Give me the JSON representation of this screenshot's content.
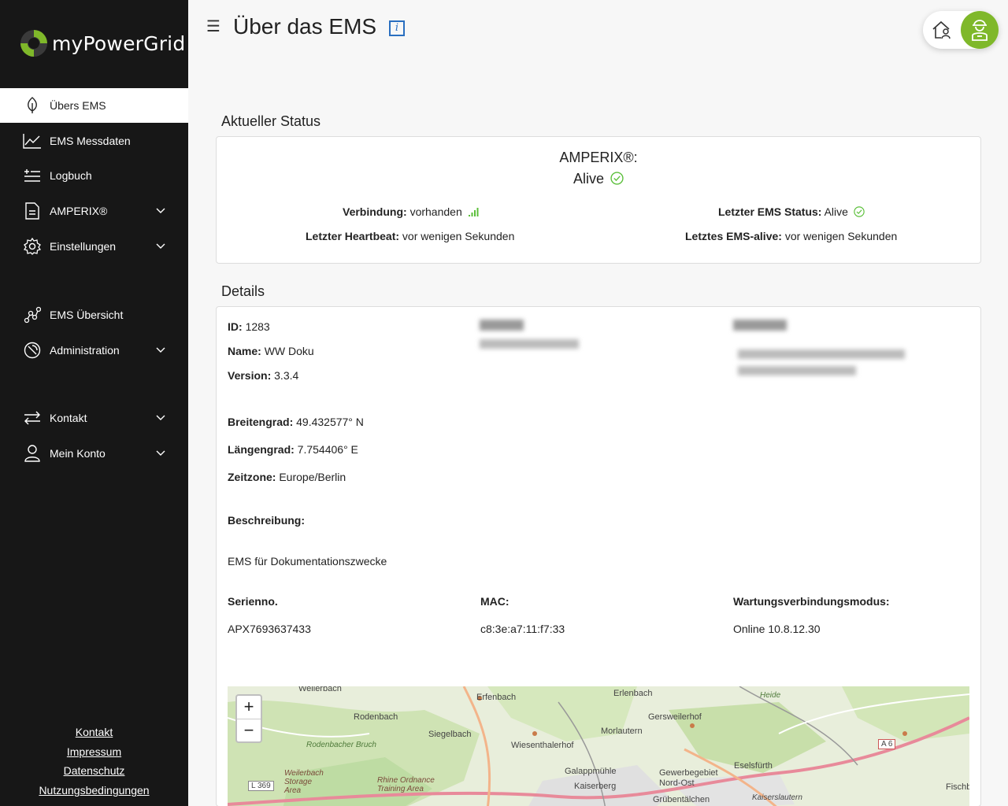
{
  "app": {
    "name": "myPowerGrid"
  },
  "nav": {
    "items": [
      {
        "label": "Übers EMS"
      },
      {
        "label": "EMS Messdaten"
      },
      {
        "label": "Logbuch"
      },
      {
        "label": "AMPERIX®"
      },
      {
        "label": "Einstellungen"
      },
      {
        "label": "EMS Übersicht"
      },
      {
        "label": "Administration"
      },
      {
        "label": "Kontakt"
      },
      {
        "label": "Mein Konto"
      }
    ],
    "footer": [
      "Kontakt",
      "Impressum",
      "Datenschutz",
      "Nutzungsbedingungen"
    ]
  },
  "header": {
    "title": "Über das EMS",
    "info": "i"
  },
  "status": {
    "section_title": "Aktueller Status",
    "device": "AMPERIX®:",
    "state": "Alive",
    "verbindung_label": "Verbindung:",
    "verbindung_value": "vorhanden",
    "heartbeat_label": "Letzter Heartbeat:",
    "heartbeat_value": "vor wenigen Sekunden",
    "ems_status_label": "Letzter EMS Status:",
    "ems_status_value": "Alive",
    "ems_alive_label": "Letztes EMS-alive:",
    "ems_alive_value": "vor wenigen Sekunden"
  },
  "details": {
    "section_title": "Details",
    "id_label": "ID:",
    "id_value": "1283",
    "name_label": "Name:",
    "name_value": "WW Doku",
    "version_label": "Version:",
    "version_value": "3.3.4",
    "lat_label": "Breitengrad:",
    "lat_value": "49.432577° N",
    "lon_label": "Längengrad:",
    "lon_value": "7.754406° E",
    "tz_label": "Zeitzone:",
    "tz_value": "Europe/Berlin",
    "desc_label": "Beschreibung:",
    "desc_value": "EMS für Dokumentationszwecke",
    "serial_label": "Serienno.",
    "serial_value": "APX7693637433",
    "mac_label": "MAC:",
    "mac_value": "c8:3e:a7:11:f7:33",
    "maint_label": "Wartungsverbindungsmodus:",
    "maint_value": "Online 10.8.12.30"
  },
  "map": {
    "zoom_in": "+",
    "zoom_out": "−",
    "labels": [
      "Weilerbach",
      "Erfenbach",
      "Erlenbach",
      "Rodenbach",
      "Gersweilerhof",
      "Siegelbach",
      "Morlautern",
      "Rodenbacher Bruch",
      "Wiesenthalerhof",
      "A 6",
      "Eselsfürth",
      "Galappmühle",
      "Gewerbegebiet Nord-Ost",
      "Kaiserberg",
      "Weilerbach Storage Area",
      "Rhine Ordnance Training Area",
      "L 369",
      "Grübentälchen",
      "Kaiserslautern",
      "Fischb",
      "Heide"
    ]
  },
  "colors": {
    "sidebar": "#171717",
    "accent": "#7fb82a",
    "ok": "#5bbf3a",
    "info": "#2a6fc0"
  }
}
